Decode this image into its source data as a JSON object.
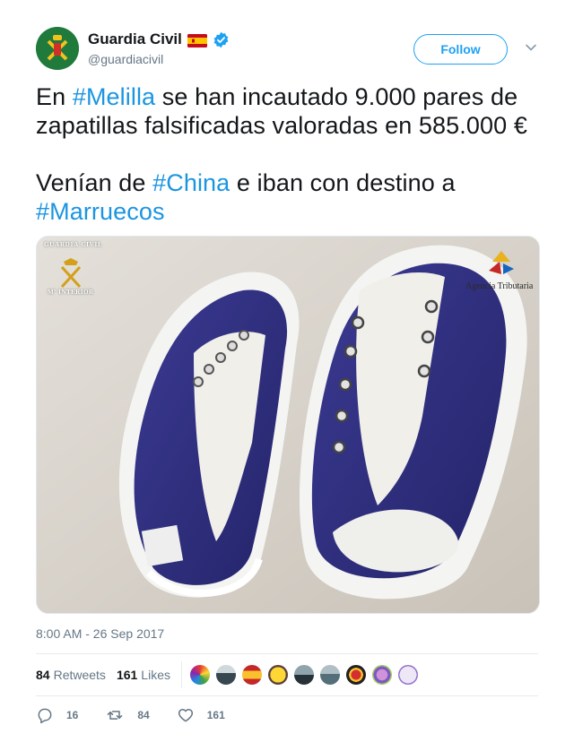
{
  "account": {
    "display_name": "Guardia Civil",
    "handle": "@guardiacivil",
    "follow_label": "Follow"
  },
  "tweet": {
    "line1_pre": "En ",
    "hashtag_melilla": "#Melilla",
    "line1_post": " se han incautado 9.000 pares de zapatillas falsificadas valoradas en 585.000 €",
    "line2_pre": "Venían de ",
    "hashtag_china": "#China",
    "line2_post": " e iban con destino a",
    "hashtag_marruecos": "#Marruecos"
  },
  "media": {
    "watermark_left_top": "GUARDIA CIVIL",
    "watermark_left_bottom": "Mº INTERIOR",
    "watermark_right": "Agencia Tributaria"
  },
  "timestamp": "8:00 AM - 26 Sep 2017",
  "stats": {
    "retweets_count": "84",
    "retweets_label": "Retweets",
    "likes_count": "161",
    "likes_label": "Likes"
  },
  "actions": {
    "replies": "16",
    "retweets": "84",
    "likes": "161"
  },
  "colors": {
    "link": "#1b95e0",
    "follow": "#1da1f2",
    "muted": "#657786"
  },
  "icons": [
    "guardia-civil-emblem-icon",
    "spain-flag-icon",
    "verified-badge-icon",
    "chevron-down-icon",
    "reply-icon",
    "retweet-icon",
    "heart-icon"
  ]
}
